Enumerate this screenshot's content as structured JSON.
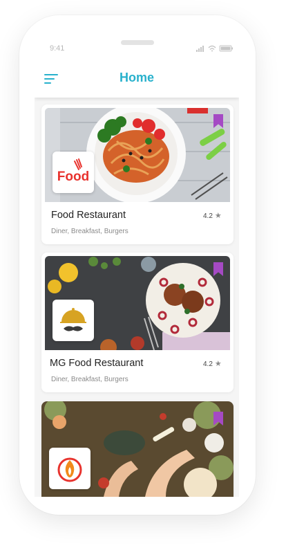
{
  "status": {
    "time": "9:41"
  },
  "header": {
    "title": "Home"
  },
  "restaurants": [
    {
      "name": "Food Restaurant",
      "tags": "Diner, Breakfast, Burgers",
      "rating": "4.2",
      "logo_text": "Food"
    },
    {
      "name": "MG Food Restaurant",
      "tags": "Diner, Breakfast, Burgers",
      "rating": "4.2"
    },
    {}
  ],
  "colors": {
    "accent": "#28b1cc",
    "bookmark": "#a54ac4",
    "logo_red": "#e8332e"
  }
}
